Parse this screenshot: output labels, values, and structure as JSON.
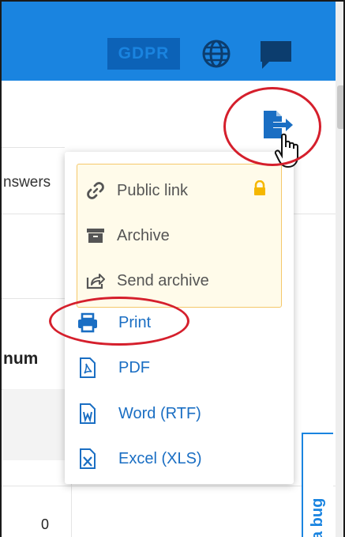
{
  "header": {
    "gdpr_label": "GDPR",
    "globe_icon": "globe-icon",
    "chat_icon": "chat-icon",
    "background_color": "#1a84e0"
  },
  "background_table": {
    "answers_fragment": "nswers",
    "column_header_fragment": "num",
    "cell_value": "0"
  },
  "export_menu": {
    "trigger_icon": "export-icon",
    "locked_items": [
      {
        "label": "Public link",
        "icon": "link-icon"
      },
      {
        "label": "Archive",
        "icon": "archive-icon"
      },
      {
        "label": "Send archive",
        "icon": "share-icon"
      }
    ],
    "lock_icon": "lock-icon",
    "items": [
      {
        "label": "Print",
        "icon": "print-icon"
      },
      {
        "label": "PDF",
        "icon": "pdf-file-icon"
      },
      {
        "label": "Word (RTF)",
        "icon": "word-file-icon"
      },
      {
        "label": "Excel (XLS)",
        "icon": "excel-file-icon"
      }
    ],
    "accent_color": "#1a6ec3",
    "locked_bg": "#fffbea"
  },
  "feedback_tab": {
    "label": "a bug"
  },
  "annotation_color": "#d51f2c"
}
